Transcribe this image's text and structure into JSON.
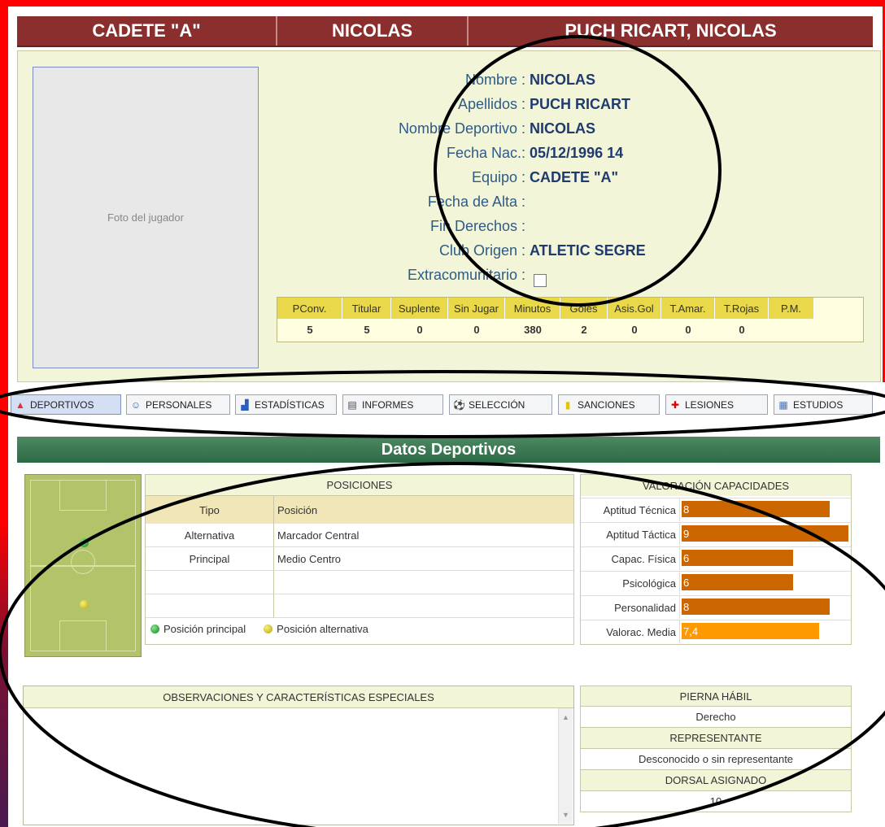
{
  "header": {
    "team": "CADETE \"A\"",
    "nickname": "NICOLAS",
    "full_name": "PUCH RICART, NICOLAS"
  },
  "photo": {
    "alt": "Foto del jugador"
  },
  "info": [
    {
      "label": "Nombre :",
      "value": "NICOLAS"
    },
    {
      "label": "Apellidos :",
      "value": "PUCH RICART"
    },
    {
      "label": "Nombre Deportivo :",
      "value": "NICOLAS"
    },
    {
      "label": "Fecha Nac.:",
      "value": "05/12/1996 14"
    },
    {
      "label": "Equipo :",
      "value": "CADETE \"A\""
    },
    {
      "label": "Fecha de Alta :",
      "value": ""
    },
    {
      "label": "Fin Derechos :",
      "value": ""
    },
    {
      "label": "Club Origen :",
      "value": "ATLETIC SEGRE"
    },
    {
      "label": "Extracomunitario :",
      "value": ""
    }
  ],
  "stats": {
    "headers": [
      "PConv.",
      "Titular",
      "Suplente",
      "Sin Jugar",
      "Minutos",
      "Goles",
      "Asis.Gol",
      "T.Amar.",
      "T.Rojas",
      "P.M."
    ],
    "values": [
      "5",
      "5",
      "0",
      "0",
      "380",
      "2",
      "0",
      "0",
      "0",
      ""
    ]
  },
  "tabs": [
    {
      "label": "DEPORTIVOS",
      "icon": "cone-icon"
    },
    {
      "label": "PERSONALES",
      "icon": "person-icon"
    },
    {
      "label": "ESTADÍSTICAS",
      "icon": "chart-icon"
    },
    {
      "label": "INFORMES",
      "icon": "report-icon"
    },
    {
      "label": "SELECCIÓN",
      "icon": "ball-icon"
    },
    {
      "label": "SANCIONES",
      "icon": "card-icon"
    },
    {
      "label": "LESIONES",
      "icon": "cross-icon"
    },
    {
      "label": "ESTUDIOS",
      "icon": "book-icon"
    }
  ],
  "section_title": "Datos Deportivos",
  "positions": {
    "title": "POSICIONES",
    "col_tipo": "Tipo",
    "col_posicion": "Posición",
    "rows": [
      {
        "tipo": "Alternativa",
        "posicion": "Marcador Central"
      },
      {
        "tipo": "Principal",
        "posicion": "Medio Centro"
      },
      {
        "tipo": "",
        "posicion": ""
      },
      {
        "tipo": "",
        "posicion": ""
      }
    ],
    "legend_principal": "Posición principal",
    "legend_alternativa": "Posición alternativa"
  },
  "valoracion": {
    "title": "VALORACIÓN CAPACIDADES",
    "rows": [
      {
        "label": "Aptitud Técnica",
        "value": "8",
        "score": 8,
        "color": "#cc6600"
      },
      {
        "label": "Aptitud Táctica",
        "value": "9",
        "score": 9,
        "color": "#cc6600"
      },
      {
        "label": "Capac. Física",
        "value": "6",
        "score": 6,
        "color": "#cc6600"
      },
      {
        "label": "Psicológica",
        "value": "6",
        "score": 6,
        "color": "#cc6600"
      },
      {
        "label": "Personalidad",
        "value": "8",
        "score": 8,
        "color": "#cc6600"
      },
      {
        "label": "Valorac. Media",
        "value": "7,4",
        "score": 7.4,
        "color": "#ff9900"
      }
    ]
  },
  "observaciones": {
    "title": "OBSERVACIONES Y CARACTERÍSTICAS ESPECIALES",
    "text": ""
  },
  "side": {
    "pierna_title": "PIERNA HÁBIL",
    "pierna_value": "Derecho",
    "representante_title": "REPRESENTANTE",
    "representante_value": "Desconocido o sin representante",
    "dorsal_title": "DORSAL ASIGNADO",
    "dorsal_value": "10"
  },
  "colors": {
    "header": "#8b2e2e",
    "section": "#2c6a45",
    "card": "#f2f5d8",
    "stats_header": "#e8d84a",
    "frame": "#ff0000"
  }
}
